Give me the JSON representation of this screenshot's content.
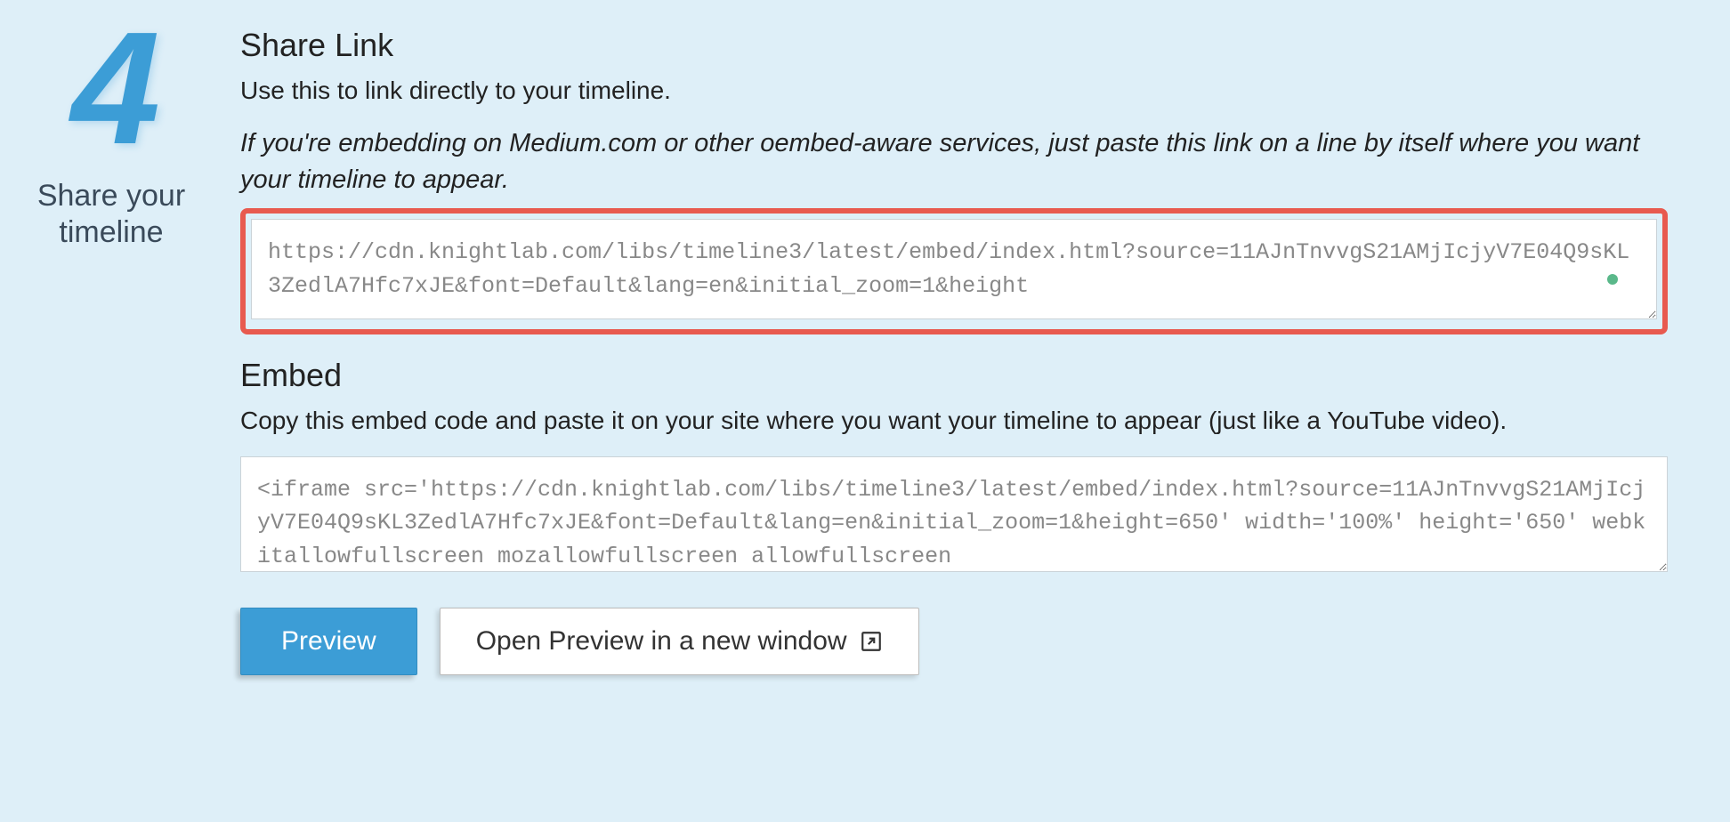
{
  "step": {
    "number": "4",
    "label": "Share your timeline"
  },
  "shareLink": {
    "heading": "Share Link",
    "description": "Use this to link directly to your timeline.",
    "note": "If you're embedding on Medium.com or other oembed-aware services, just paste this link on a line by itself where you want your timeline to appear.",
    "value": "https://cdn.knightlab.com/libs/timeline3/latest/embed/index.html?source=11AJnTnvvgS21AMjIcjyV7E04Q9sKL3ZedlA7Hfc7xJE&font=Default&lang=en&initial_zoom=1&height"
  },
  "embed": {
    "heading": "Embed",
    "description": "Copy this embed code and paste it on your site where you want your timeline to appear (just like a YouTube video).",
    "value": "<iframe src='https://cdn.knightlab.com/libs/timeline3/latest/embed/index.html?source=11AJnTnvvgS21AMjIcjyV7E04Q9sKL3ZedlA7Hfc7xJE&font=Default&lang=en&initial_zoom=1&height=650' width='100%' height='650' webkitallowfullscreen mozallowfullscreen allowfullscreen"
  },
  "buttons": {
    "preview": "Preview",
    "openNew": "Open Preview in a new window"
  }
}
